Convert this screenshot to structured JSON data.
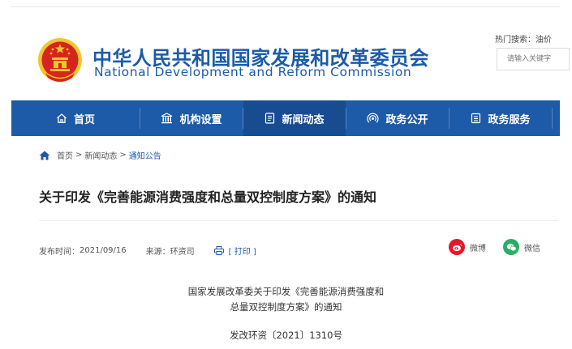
{
  "header": {
    "title_cn": "中华人民共和国国家发展和改革委员会",
    "title_en": "National Development and Reform Commission",
    "hot_search_label": "热门搜索：",
    "hot_search_term": "油价",
    "search_placeholder": "请输入关键字"
  },
  "nav": {
    "items": [
      {
        "label": "首页",
        "icon": "home-icon"
      },
      {
        "label": "机构设置",
        "icon": "building-icon"
      },
      {
        "label": "新闻动态",
        "icon": "news-icon",
        "active": true
      },
      {
        "label": "政务公开",
        "icon": "broadcast-icon"
      },
      {
        "label": "政务服务",
        "icon": "service-icon"
      }
    ]
  },
  "breadcrumb": {
    "home": "首页",
    "news": "新闻动态",
    "current": "通知公告",
    "separator": ">"
  },
  "article": {
    "title": "关于印发《完善能源消费强度和总量双控制度方案》的通知",
    "publish_label": "发布时间：",
    "publish_date": "2021/09/16",
    "source_label": "来源：",
    "source": "环资司",
    "print_label": "[ 打印 ]",
    "share_weibo": "微博",
    "share_wechat": "微信",
    "doc_heading_line1": "国家发展改革委关于印发《完善能源消费强度和",
    "doc_heading_line2": "总量双控制度方案》的通知",
    "doc_number": "发改环资〔2021〕1310号"
  },
  "colors": {
    "brand_blue": "#1d5aa8",
    "nav_active": "#174c91",
    "emblem_red": "#d7241c",
    "emblem_gold": "#f2c62f",
    "weibo_red": "#e6162d",
    "wechat_green": "#2aae67"
  }
}
